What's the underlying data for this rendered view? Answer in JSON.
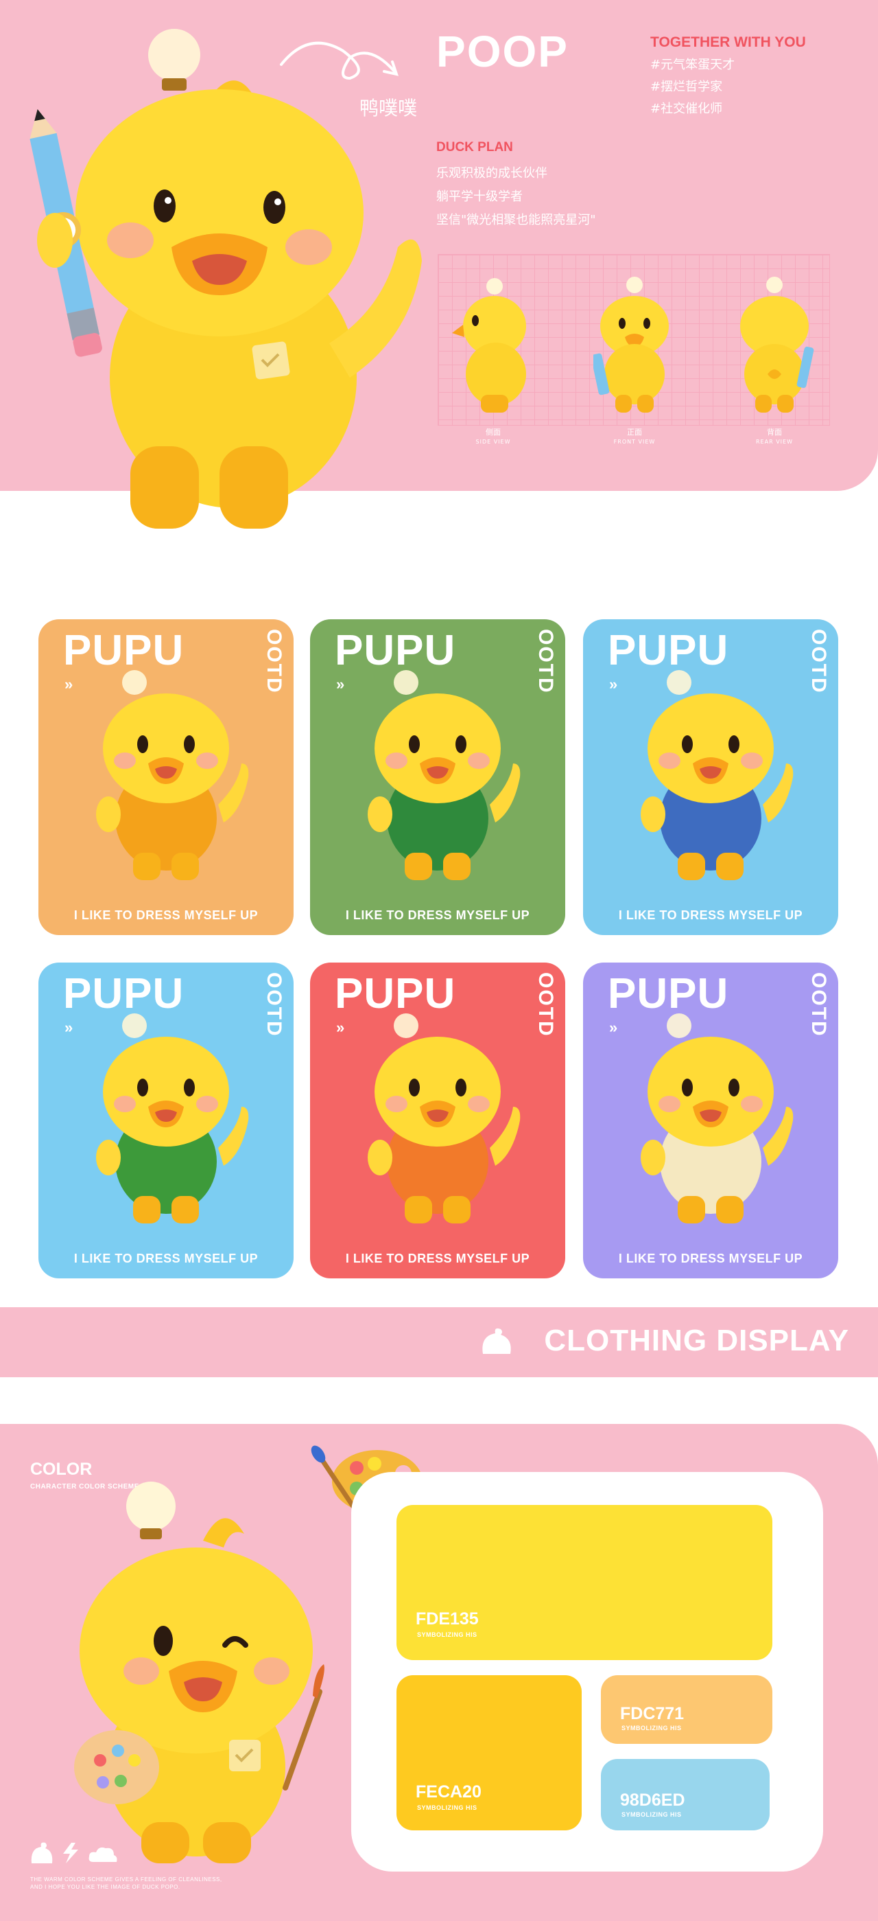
{
  "hero": {
    "title": "POOP",
    "handle": "鸭噗噗",
    "together": {
      "heading": "TOGETHER WITH YOU",
      "tags": [
        "#元气笨蛋天才",
        "#摆烂哲学家",
        "#社交催化师"
      ]
    },
    "plan": {
      "heading": "DUCK PLAN",
      "lines": [
        "乐观积极的成长伙伴",
        "躺平学十级学者",
        "坚信\"微光相聚也能照亮星河\""
      ]
    },
    "turnaround": [
      {
        "label": "侧面",
        "label_en": "SIDE VIEW"
      },
      {
        "label": "正面",
        "label_en": "FRONT VIEW"
      },
      {
        "label": "背面",
        "label_en": "REAR VIEW"
      }
    ]
  },
  "cards": [
    {
      "title": "PUPU",
      "side": "OOTD",
      "chevrons": "»",
      "caption": "I LIKE TO DRESS MYSELF UP",
      "bg": "#f6b46a",
      "outfit": "astronaut",
      "accent": "#f4a21a"
    },
    {
      "title": "PUPU",
      "side": "OOTD",
      "chevrons": "»",
      "caption": "I LIKE TO DRESS MYSELF UP",
      "bg": "#7bab5e",
      "outfit": "dinosaur-hoodie",
      "accent": "#2f8a3c"
    },
    {
      "title": "PUPU",
      "side": "OOTD",
      "chevrons": "»",
      "caption": "I LIKE TO DRESS MYSELF UP",
      "bg": "#7ccbef",
      "outfit": "business-suit",
      "accent": "#3e6cc0"
    },
    {
      "title": "PUPU",
      "side": "OOTD",
      "chevrons": "»",
      "caption": "I LIKE TO DRESS MYSELF UP",
      "bg": "#7ccdf2",
      "outfit": "overalls",
      "accent": "#3d9a3a"
    },
    {
      "title": "PUPU",
      "side": "OOTD",
      "chevrons": "»",
      "caption": "I LIKE TO DRESS MYSELF UP",
      "bg": "#f46565",
      "outfit": "headphones-hoodie",
      "accent": "#f27a2a"
    },
    {
      "title": "PUPU",
      "side": "OOTD",
      "chevrons": "»",
      "caption": "I LIKE TO DRESS MYSELF UP",
      "bg": "#a79af2",
      "outfit": "explorer",
      "accent": "#f5e8c0"
    }
  ],
  "band": {
    "title": "CLOTHING DISPLAY"
  },
  "colors": {
    "heading": "COLOR",
    "subheading": "CHARACTER COLOR SCHEME",
    "footer_lines": [
      "THE WARM COLOR SCHEME GIVES A FEELING OF CLEANLINESS,",
      "AND I HOPE YOU LIKE THE IMAGE OF DUCK POPO."
    ],
    "swatches": [
      {
        "hex": "FDE135",
        "note": "SYMBOLIZING HIS",
        "color": "#fde135"
      },
      {
        "hex": "FECA20",
        "note": "SYMBOLIZING HIS",
        "color": "#feca20"
      },
      {
        "hex": "FDC771",
        "note": "SYMBOLIZING HIS",
        "color": "#fdc771"
      },
      {
        "hex": "98D6ED",
        "note": "SYMBOLIZING HIS",
        "color": "#98d6ed"
      }
    ]
  },
  "palette": {
    "pink": "#f8bccb",
    "duck_yellow": "#ffd93a",
    "accent_red": "#f0535f"
  }
}
